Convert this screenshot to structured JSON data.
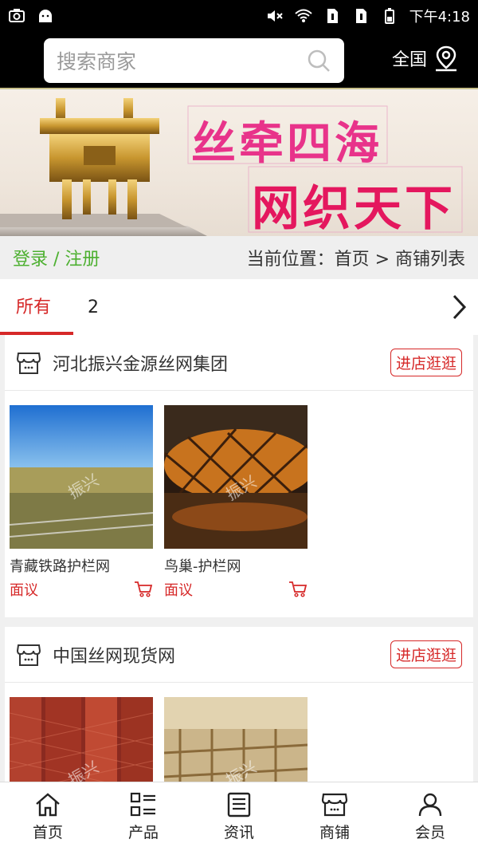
{
  "status_bar": {
    "time": "下午4:18"
  },
  "search": {
    "placeholder": "搜索商家"
  },
  "header": {
    "region_label": "全国"
  },
  "banner": {
    "line1": "丝牵四海",
    "line2": "网织天下"
  },
  "breadcrumb": {
    "login_label": "登录 / 注册",
    "path": "当前位置：首页 > 商铺列表"
  },
  "tabs": [
    {
      "label": "所有"
    },
    {
      "label": "2"
    }
  ],
  "shops": [
    {
      "name": "河北振兴金源丝网集团",
      "visit_label": "进店逛逛",
      "products": [
        {
          "name": "青藏铁路护栏网",
          "price": "面议",
          "watermark": "振兴"
        },
        {
          "name": "鸟巢-护栏网",
          "price": "面议",
          "watermark": "振兴"
        }
      ]
    },
    {
      "name": "中国丝网现货网",
      "visit_label": "进店逛逛",
      "products": [
        {
          "name": "",
          "price": "",
          "watermark": "振兴"
        },
        {
          "name": "",
          "price": "",
          "watermark": "振兴"
        }
      ]
    }
  ],
  "bottom_nav": [
    {
      "label": "首页",
      "icon": "home-icon"
    },
    {
      "label": "产品",
      "icon": "list-icon"
    },
    {
      "label": "资讯",
      "icon": "news-icon"
    },
    {
      "label": "商铺",
      "icon": "store-icon"
    },
    {
      "label": "会员",
      "icon": "user-icon"
    }
  ],
  "colors": {
    "accent_red": "#d62828",
    "login_green": "#4db030",
    "header_black": "#000000"
  }
}
